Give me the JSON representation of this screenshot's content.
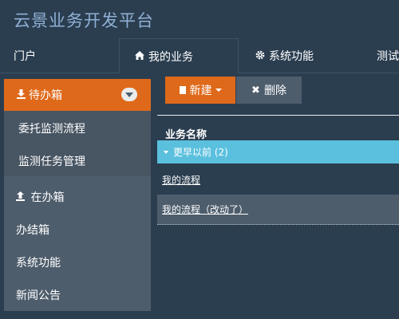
{
  "app": {
    "title": "云景业务开发平台"
  },
  "nav": {
    "portal": "门户",
    "business": "我的业务",
    "system": "系统功能",
    "test": "测试"
  },
  "sidebar": {
    "pending": "待办箱",
    "pending_children": [
      "委托监测流程",
      "监测任务管理"
    ],
    "in_progress": "在办箱",
    "done": "办结箱",
    "system": "系统功能",
    "news": "新闻公告"
  },
  "toolbar": {
    "new_label": "新建",
    "delete_label": "删除"
  },
  "table": {
    "column_header": "业务名称",
    "group_label": "更早以前 (2)",
    "rows": [
      "我的流程",
      "我的流程（改动了）"
    ]
  },
  "colors": {
    "accent": "#df691a",
    "background": "#2b3e50",
    "panel": "#4e5d6c",
    "info": "#5bc0de"
  },
  "icons": {
    "home": "home-icon",
    "gear": "gear-icon",
    "download": "download-icon",
    "upload": "upload-icon",
    "file": "file-icon",
    "close": "close-icon"
  }
}
